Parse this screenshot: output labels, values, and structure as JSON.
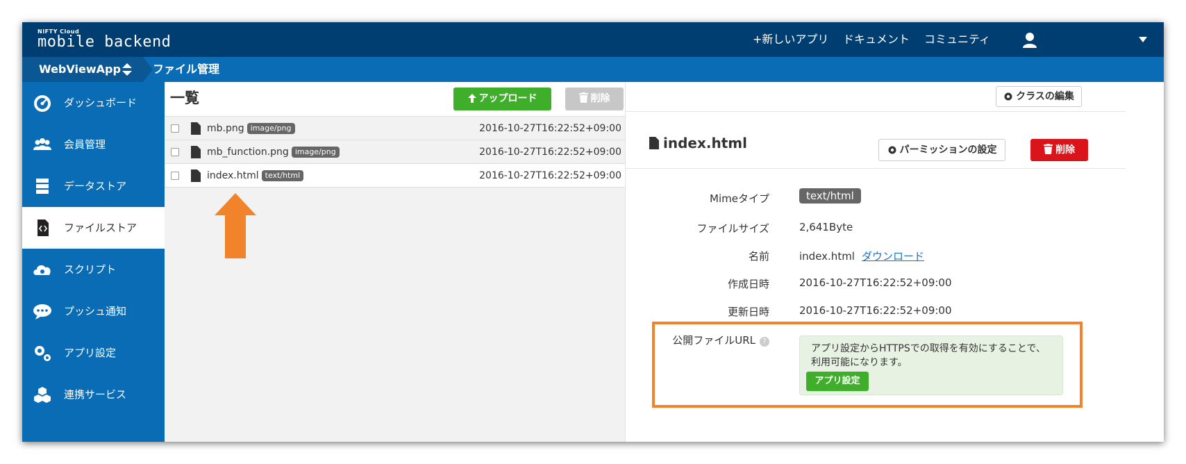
{
  "header": {
    "brand_small": "NIFTY Cloud",
    "brand_main": "mobile backend",
    "nav": [
      "+新しいアプリ",
      "ドキュメント",
      "コミュニティ"
    ]
  },
  "subbar": {
    "app_name": "WebViewApp",
    "breadcrumb": "ファイル管理"
  },
  "sidebar": {
    "items": [
      {
        "label": "ダッシュボード",
        "icon": "dashboard-icon"
      },
      {
        "label": "会員管理",
        "icon": "users-icon"
      },
      {
        "label": "データストア",
        "icon": "database-icon"
      },
      {
        "label": "ファイルストア",
        "icon": "file-code-icon"
      },
      {
        "label": "スクリプト",
        "icon": "cloud-gear-icon"
      },
      {
        "label": "プッシュ通知",
        "icon": "chat-bubble-icon"
      },
      {
        "label": "アプリ設定",
        "icon": "gears-icon"
      },
      {
        "label": "連携サービス",
        "icon": "cubes-icon"
      }
    ]
  },
  "list": {
    "title": "一覧",
    "upload_label": "アップロード",
    "delete_label": "削除",
    "files": [
      {
        "name": "mb.png",
        "type": "image/png",
        "date": "2016-10-27T16:22:52+09:00"
      },
      {
        "name": "mb_function.png",
        "type": "image/png",
        "date": "2016-10-27T16:22:52+09:00"
      },
      {
        "name": "index.html",
        "type": "text/html",
        "date": "2016-10-27T16:22:52+09:00"
      }
    ]
  },
  "detail": {
    "class_edit_label": "クラスの編集",
    "title": "index.html",
    "permission_label": "パーミッションの設定",
    "delete_label": "削除",
    "mime_label": "Mimeタイプ",
    "mime_value": "text/html",
    "size_label": "ファイルサイズ",
    "size_value": "2,641Byte",
    "name_label": "名前",
    "name_value": "index.html",
    "download_label": "ダウンロード",
    "created_label": "作成日時",
    "created_value": "2016-10-27T16:22:52+09:00",
    "updated_label": "更新日時",
    "updated_value": "2016-10-27T16:22:52+09:00",
    "public_url_label": "公開ファイルURL",
    "public_url_help": "?",
    "notice_text": "アプリ設定からHTTPSでの取得を有効にすることで、利用可能になります。",
    "app_settings_label": "アプリ設定"
  },
  "colors": {
    "topbar": "#003e71",
    "brand_blue": "#0a6cb5",
    "green": "#3fae2a",
    "red": "#d9141b",
    "annotation_orange": "#f1832a"
  }
}
